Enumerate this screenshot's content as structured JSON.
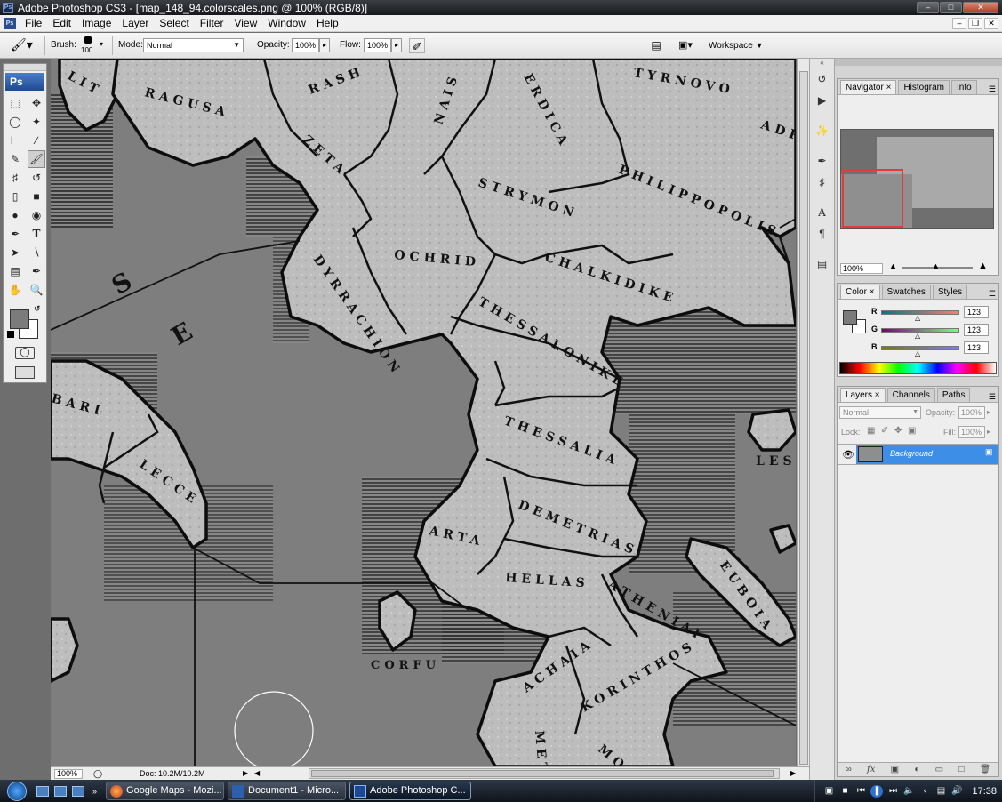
{
  "window": {
    "title": "Adobe Photoshop CS3 - [map_148_94.colorscales.png @ 100% (RGB/8)]",
    "controls": [
      "minimize-icon",
      "maximize-icon",
      "close-icon"
    ]
  },
  "menubar": {
    "items": [
      "File",
      "Edit",
      "Image",
      "Layer",
      "Select",
      "Filter",
      "View",
      "Window",
      "Help"
    ]
  },
  "options": {
    "brush_label": "Brush:",
    "brush_size": "100",
    "mode_label": "Mode:",
    "mode_value": "Normal",
    "opacity_label": "Opacity:",
    "opacity_value": "100%",
    "flow_label": "Flow:",
    "flow_value": "100%",
    "workspace_label": "Workspace"
  },
  "toolbox": {
    "logo": "Ps",
    "tools": [
      "marquee-icon",
      "move-icon",
      "lasso-icon",
      "magic-wand-icon",
      "crop-icon",
      "slice-icon",
      "healing-brush-icon",
      "brush-icon",
      "clone-stamp-icon",
      "history-brush-icon",
      "eraser-icon",
      "gradient-icon",
      "blur-icon",
      "dodge-icon",
      "pen-icon",
      "type-icon",
      "path-selection-icon",
      "line-icon",
      "notes-icon",
      "eyedropper-icon",
      "hand-icon",
      "zoom-icon"
    ],
    "foreground_color": "#7b7b7b",
    "background_color": "#ffffff"
  },
  "map": {
    "labels": {
      "ragusa": "RAGUSA",
      "rash": "RASH",
      "nais": "NAIS",
      "serdica": "ERDICA",
      "tyrnovo": "TYRNOVO",
      "adri": "ADRI",
      "zeta": "ZETA",
      "strymon": "STRYMON",
      "philippopolis": "PHILIPPOPOLIS",
      "ochrid": "OCHRID",
      "dyrrachion": "DYRRACHION",
      "chalkidike": "CHALKIDIKE",
      "thessalonike": "THESSALONIKE",
      "thessalia": "THESSALIA",
      "bari": "BARI",
      "lecce": "LECCE",
      "demetrias": "DEMETRIAS",
      "arta": "ARTA",
      "hellas": "HELLAS",
      "atheniai": "ATHENIAI",
      "euboia": "EUBOIA",
      "lesbo": "LESBO",
      "corfu": "CORFU",
      "achaia": "ACHAIA",
      "korinthos": "KORINTHOS",
      "meth": "METH",
      "mon": "MON",
      "sea_s": "S",
      "sea_e": "E",
      "lit": "LIT"
    },
    "land_color": "#bdbdbd",
    "sea_color": "#7e7e7e"
  },
  "status": {
    "zoom": "100%",
    "doc": "Doc: 10.2M/10.2M"
  },
  "navigator": {
    "tabs": [
      "Navigator",
      "Histogram",
      "Info"
    ],
    "zoom": "100%"
  },
  "color_panel": {
    "tabs": [
      "Color",
      "Swatches",
      "Styles"
    ],
    "channels": [
      {
        "name": "R",
        "value": "123"
      },
      {
        "name": "G",
        "value": "123"
      },
      {
        "name": "B",
        "value": "123"
      }
    ]
  },
  "layers_panel": {
    "tabs": [
      "Layers",
      "Channels",
      "Paths"
    ],
    "blend_mode": "Normal",
    "opacity_label": "Opacity:",
    "opacity_value": "100%",
    "lock_label": "Lock:",
    "fill_label": "Fill:",
    "fill_value": "100%",
    "layers": [
      {
        "name": "Background",
        "selected": true,
        "locked": true,
        "visible": true
      }
    ]
  },
  "taskbar": {
    "tasks": [
      {
        "label": "Google Maps - Mozi...",
        "icon": "firefox-icon",
        "active": false
      },
      {
        "label": "Document1 - Micro...",
        "icon": "word-icon",
        "active": false
      },
      {
        "label": "Adobe Photoshop C...",
        "icon": "photoshop-icon",
        "active": true
      }
    ],
    "clock": "17:38"
  }
}
